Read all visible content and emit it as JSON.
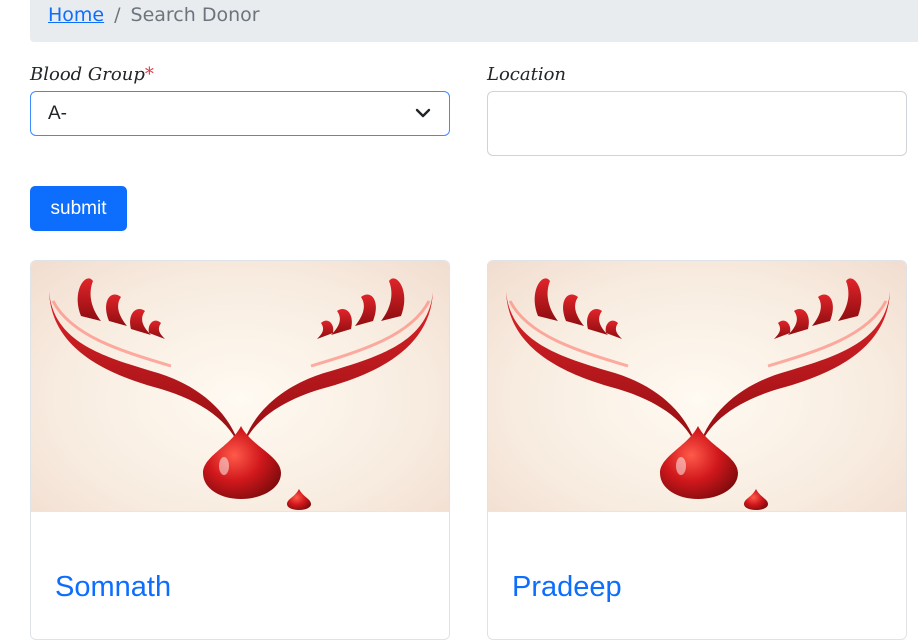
{
  "breadcrumb": {
    "home": "Home",
    "separator": "/",
    "current": "Search Donor"
  },
  "form": {
    "blood_group_label": "Blood Group",
    "blood_group_required_mark": "*",
    "blood_group_value": "A-",
    "location_label": "Location",
    "location_value": "",
    "submit_label": "submit"
  },
  "donors": [
    {
      "name": "Somnath",
      "image_icon": "blood-donation-hands-icon"
    },
    {
      "name": "Pradeep",
      "image_icon": "blood-donation-hands-icon"
    }
  ],
  "colors": {
    "primary": "#0d6efd",
    "breadcrumb_bg": "#e9ecef",
    "required": "#dc3545",
    "blood_red": "#c4161c"
  }
}
